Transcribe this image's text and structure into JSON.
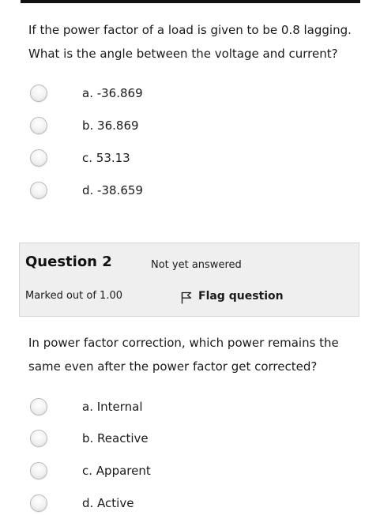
{
  "question1": {
    "text_line1": "If the power factor of a load is given to be 0.8 lagging.",
    "text_line2": "What is the angle between the voltage and current?",
    "options": [
      "a. -36.869",
      "b. 36.869",
      "c. 53.13",
      "d. -38.659"
    ]
  },
  "question2": {
    "heading": "Question 2",
    "state": "Not yet answered",
    "marked": "Marked out of 1.00",
    "flag_label": "Flag question",
    "flag_icon": "flag-icon",
    "text_line1": "In power factor correction, which power remains the",
    "text_line2": "same even after the power factor get corrected?",
    "options": [
      "a. Internal",
      "b. Reactive",
      "c. Apparent",
      "d. Active"
    ]
  }
}
